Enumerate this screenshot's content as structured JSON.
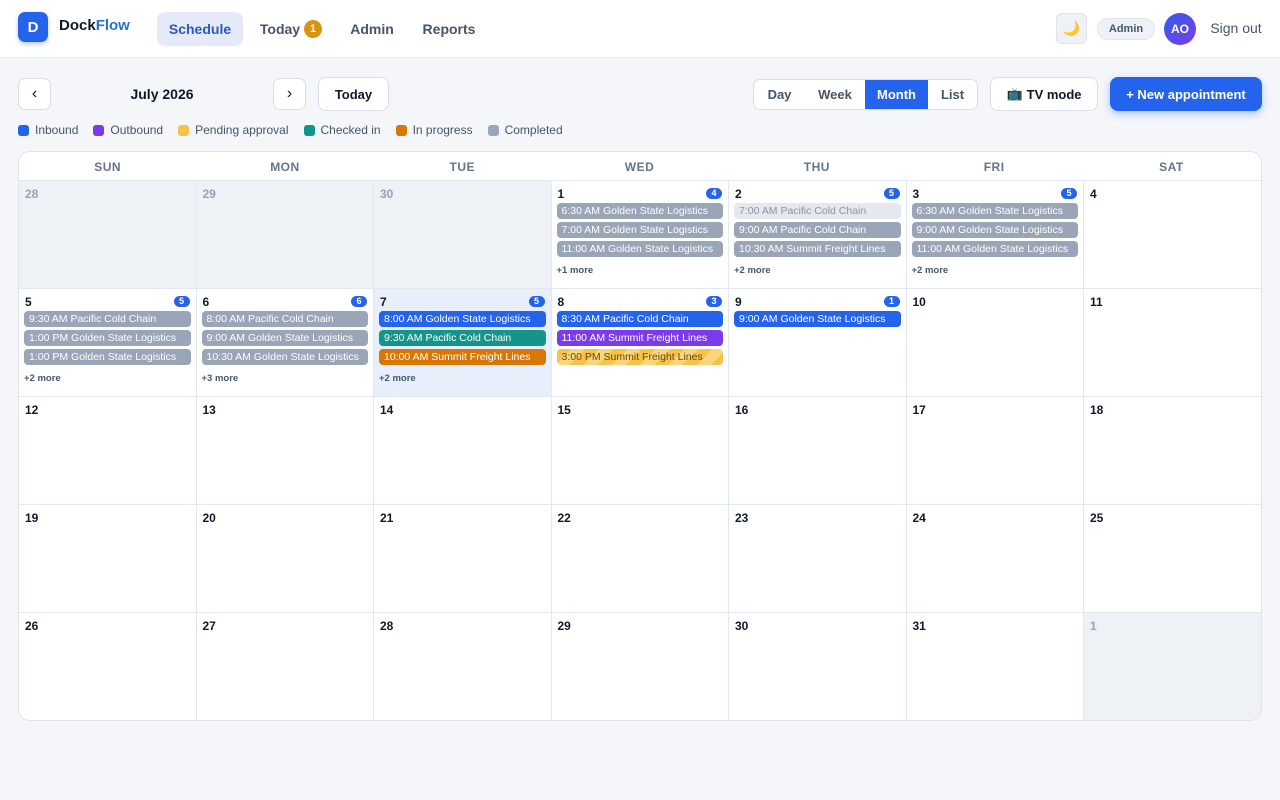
{
  "app": {
    "logo_letter": "D",
    "brand_primary": "Dock",
    "brand_accent": "Flow"
  },
  "nav": {
    "schedule": "Schedule",
    "today": "Today",
    "today_badge": "1",
    "admin": "Admin",
    "reports": "Reports"
  },
  "user": {
    "theme_icon": "moon-icon",
    "role": "Admin",
    "initials": "AO",
    "signout": "Sign out"
  },
  "toolbar": {
    "prev": "‹",
    "next": "›",
    "month_label": "July 2026",
    "today": "Today",
    "views": [
      "Day",
      "Week",
      "Month",
      "List"
    ],
    "active_view": "Month",
    "tv_icon": "📺",
    "tv_mode": "TV mode",
    "new_appointment": "+ New appointment"
  },
  "legend": [
    {
      "label": "Inbound",
      "color": "#2463eb"
    },
    {
      "label": "Outbound",
      "color": "#7c3aed"
    },
    {
      "label": "Pending approval",
      "color": "#f5c24c"
    },
    {
      "label": "Checked in",
      "color": "#14948a"
    },
    {
      "label": "In progress",
      "color": "#d97706"
    },
    {
      "label": "Completed",
      "color": "#9aa5b8"
    }
  ],
  "weekdays": [
    "SUN",
    "MON",
    "TUE",
    "WED",
    "THU",
    "FRI",
    "SAT"
  ],
  "days": [
    {
      "day": "28",
      "outside": true
    },
    {
      "day": "29",
      "outside": true
    },
    {
      "day": "30",
      "outside": true
    },
    {
      "day": "1",
      "count": "4",
      "events": [
        {
          "text": "6:30 AM Golden State Logistics",
          "status": "completed"
        },
        {
          "text": "7:00 AM Golden State Logistics",
          "status": "completed"
        },
        {
          "text": "11:00 AM Golden State Logistics",
          "status": "completed"
        }
      ],
      "more": "+1 more"
    },
    {
      "day": "2",
      "count": "5",
      "events": [
        {
          "text": "7:00 AM Pacific Cold Chain",
          "status": "faded"
        },
        {
          "text": "9:00 AM Pacific Cold Chain",
          "status": "completed"
        },
        {
          "text": "10:30 AM Summit Freight Lines",
          "status": "completed"
        }
      ],
      "more": "+2 more"
    },
    {
      "day": "3",
      "count": "5",
      "events": [
        {
          "text": "6:30 AM Golden State Logistics",
          "status": "completed"
        },
        {
          "text": "9:00 AM Golden State Logistics",
          "status": "completed"
        },
        {
          "text": "11:00 AM Golden State Logistics",
          "status": "completed"
        }
      ],
      "more": "+2 more"
    },
    {
      "day": "4"
    },
    {
      "day": "5",
      "count": "5",
      "events": [
        {
          "text": "9:30 AM Pacific Cold Chain",
          "status": "completed"
        },
        {
          "text": "1:00 PM Golden State Logistics",
          "status": "completed"
        },
        {
          "text": "1:00 PM Golden State Logistics",
          "status": "completed"
        }
      ],
      "more": "+2 more"
    },
    {
      "day": "6",
      "count": "6",
      "events": [
        {
          "text": "8:00 AM Pacific Cold Chain",
          "status": "completed"
        },
        {
          "text": "9:00 AM Golden State Logistics",
          "status": "completed"
        },
        {
          "text": "10:30 AM Golden State Logistics",
          "status": "completed"
        }
      ],
      "more": "+3 more"
    },
    {
      "day": "7",
      "today": true,
      "count": "5",
      "events": [
        {
          "text": "8:00 AM Golden State Logistics",
          "status": "inbound"
        },
        {
          "text": "9:30 AM Pacific Cold Chain",
          "status": "checkedin"
        },
        {
          "text": "10:00 AM Summit Freight Lines",
          "status": "inprogress"
        }
      ],
      "more": "+2 more"
    },
    {
      "day": "8",
      "count": "3",
      "events": [
        {
          "text": "8:30 AM Pacific Cold Chain",
          "status": "inbound"
        },
        {
          "text": "11:00 AM Summit Freight Lines",
          "status": "outbound"
        },
        {
          "text": "3:00 PM Summit Freight Lines",
          "status": "pending"
        }
      ]
    },
    {
      "day": "9",
      "count": "1",
      "events": [
        {
          "text": "9:00 AM Golden State Logistics",
          "status": "inbound"
        }
      ]
    },
    {
      "day": "10"
    },
    {
      "day": "11"
    },
    {
      "day": "12"
    },
    {
      "day": "13"
    },
    {
      "day": "14"
    },
    {
      "day": "15"
    },
    {
      "day": "16"
    },
    {
      "day": "17"
    },
    {
      "day": "18"
    },
    {
      "day": "19"
    },
    {
      "day": "20"
    },
    {
      "day": "21"
    },
    {
      "day": "22"
    },
    {
      "day": "23"
    },
    {
      "day": "24"
    },
    {
      "day": "25"
    },
    {
      "day": "26"
    },
    {
      "day": "27"
    },
    {
      "day": "28"
    },
    {
      "day": "29"
    },
    {
      "day": "30"
    },
    {
      "day": "31"
    },
    {
      "day": "1",
      "outside": true
    }
  ]
}
